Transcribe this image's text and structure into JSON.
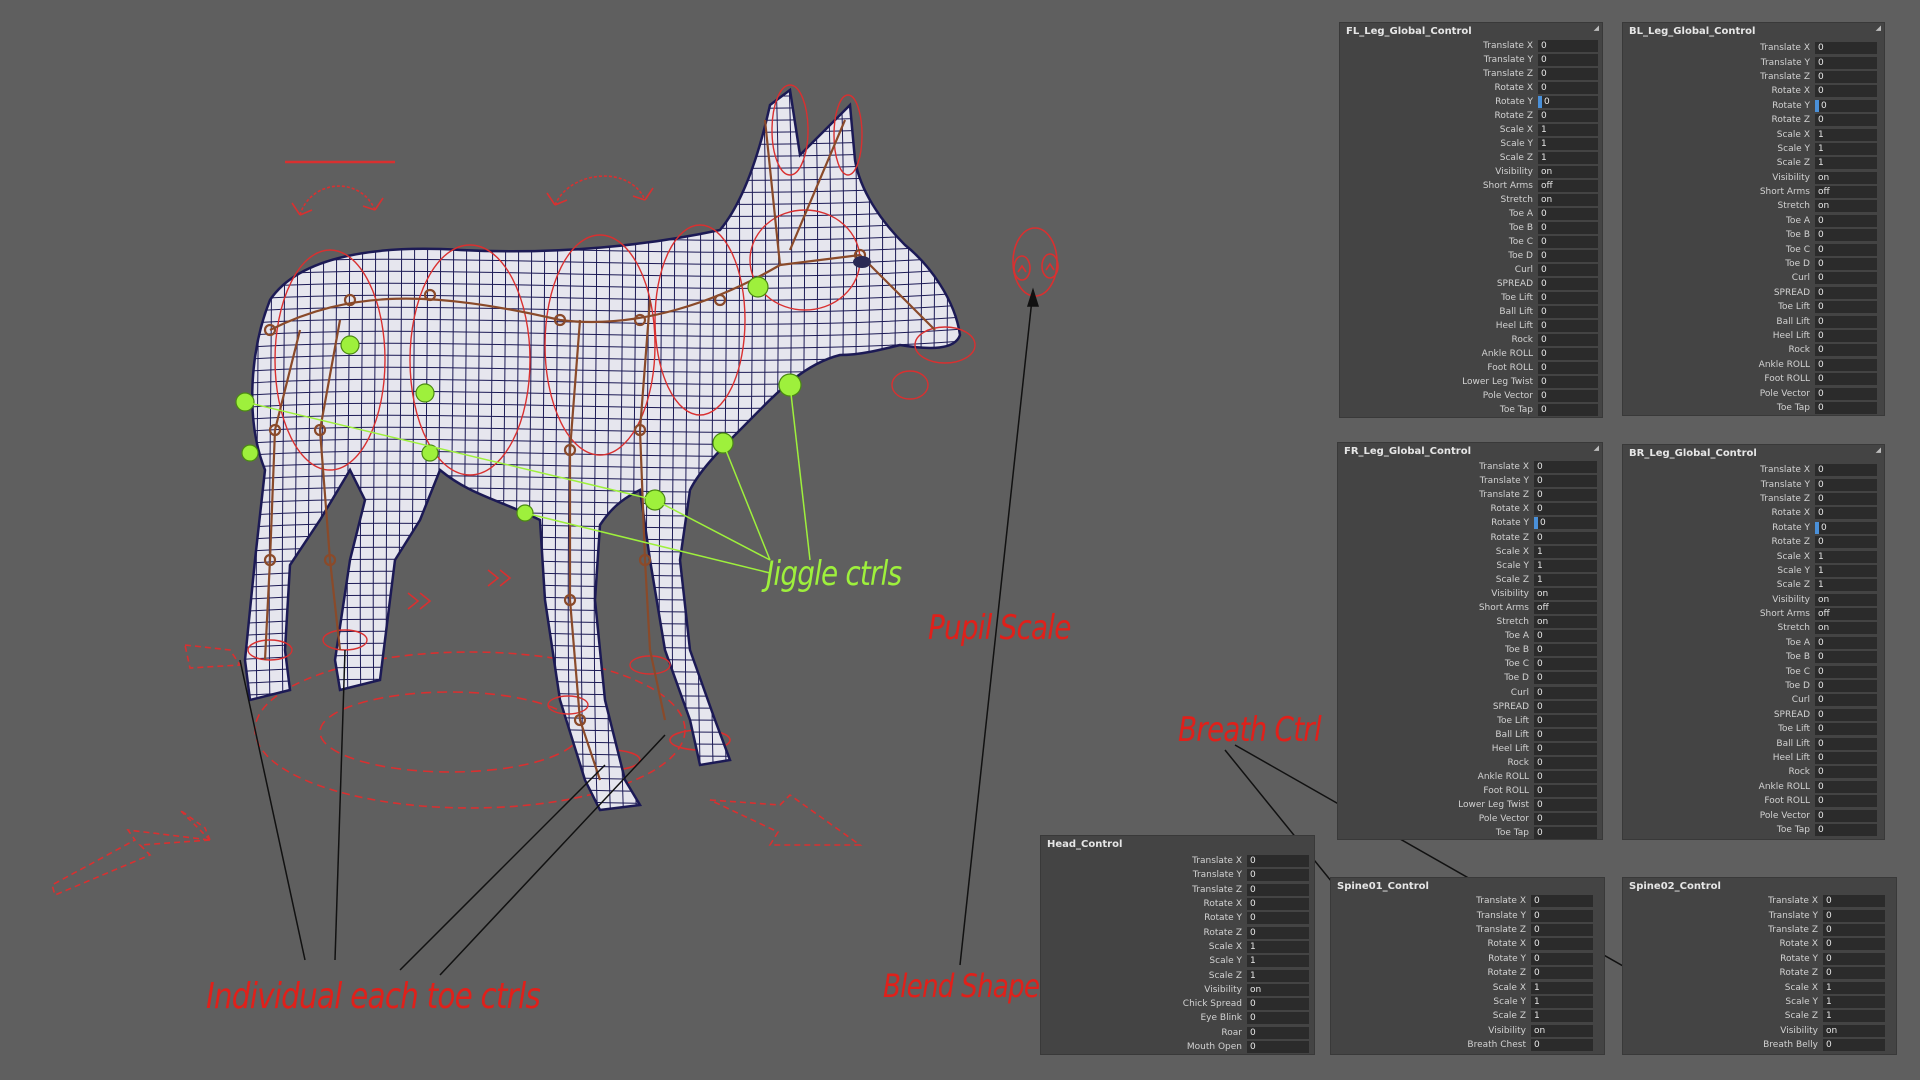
{
  "colors": {
    "background": "#5f5f5f",
    "panel_bg": "#444444",
    "field_bg": "#2b2b2b",
    "annotation_red": "#e0201a",
    "annotation_green": "#9ef03c",
    "wireframe": "#1c1a55",
    "rig_controls": "#d93030",
    "skeleton": "#8a4a2a",
    "selected_slot": "#4a90d9"
  },
  "annotations": {
    "jiggle": "Jiggle ctrls",
    "pupil": "Pupil Scale",
    "breath": "Breath Ctrl",
    "blend": "Blend Shapes",
    "toes": "Individual each toe ctrls"
  },
  "panels": {
    "fl": {
      "title": "FL_Leg_Global_Control",
      "attrs": [
        {
          "label": "Translate X",
          "value": "0"
        },
        {
          "label": "Translate Y",
          "value": "0"
        },
        {
          "label": "Translate Z",
          "value": "0"
        },
        {
          "label": "Rotate X",
          "value": "0"
        },
        {
          "label": "Rotate Y",
          "value": "0",
          "selected": true
        },
        {
          "label": "Rotate Z",
          "value": "0"
        },
        {
          "label": "Scale X",
          "value": "1"
        },
        {
          "label": "Scale Y",
          "value": "1"
        },
        {
          "label": "Scale Z",
          "value": "1"
        },
        {
          "label": "Visibility",
          "value": "on"
        },
        {
          "label": "Short Arms",
          "value": "off"
        },
        {
          "label": "Stretch",
          "value": "on"
        },
        {
          "label": "Toe A",
          "value": "0"
        },
        {
          "label": "Toe B",
          "value": "0"
        },
        {
          "label": "Toe C",
          "value": "0"
        },
        {
          "label": "Toe D",
          "value": "0"
        },
        {
          "label": "Curl",
          "value": "0"
        },
        {
          "label": "SPREAD",
          "value": "0"
        },
        {
          "label": "Toe Lift",
          "value": "0"
        },
        {
          "label": "Ball Lift",
          "value": "0"
        },
        {
          "label": "Heel Lift",
          "value": "0"
        },
        {
          "label": "Rock",
          "value": "0"
        },
        {
          "label": "Ankle ROLL",
          "value": "0"
        },
        {
          "label": "Foot ROLL",
          "value": "0"
        },
        {
          "label": "Lower Leg Twist",
          "value": "0"
        },
        {
          "label": "Pole Vector",
          "value": "0"
        },
        {
          "label": "Toe Tap",
          "value": "0"
        }
      ]
    },
    "bl": {
      "title": "BL_Leg_Global_Control",
      "attrs": [
        {
          "label": "Translate X",
          "value": "0"
        },
        {
          "label": "Translate Y",
          "value": "0"
        },
        {
          "label": "Translate Z",
          "value": "0"
        },
        {
          "label": "Rotate X",
          "value": "0"
        },
        {
          "label": "Rotate Y",
          "value": "0",
          "selected": true
        },
        {
          "label": "Rotate Z",
          "value": "0"
        },
        {
          "label": "Scale X",
          "value": "1"
        },
        {
          "label": "Scale Y",
          "value": "1"
        },
        {
          "label": "Scale Z",
          "value": "1"
        },
        {
          "label": "Visibility",
          "value": "on"
        },
        {
          "label": "Short Arms",
          "value": "off"
        },
        {
          "label": "Stretch",
          "value": "on"
        },
        {
          "label": "Toe A",
          "value": "0"
        },
        {
          "label": "Toe B",
          "value": "0"
        },
        {
          "label": "Toe C",
          "value": "0"
        },
        {
          "label": "Toe D",
          "value": "0"
        },
        {
          "label": "Curl",
          "value": "0"
        },
        {
          "label": "SPREAD",
          "value": "0"
        },
        {
          "label": "Toe Lift",
          "value": "0"
        },
        {
          "label": "Ball Lift",
          "value": "0"
        },
        {
          "label": "Heel Lift",
          "value": "0"
        },
        {
          "label": "Rock",
          "value": "0"
        },
        {
          "label": "Ankle ROLL",
          "value": "0"
        },
        {
          "label": "Foot ROLL",
          "value": "0"
        },
        {
          "label": "Pole Vector",
          "value": "0"
        },
        {
          "label": "Toe Tap",
          "value": "0"
        }
      ]
    },
    "fr": {
      "title": "FR_Leg_Global_Control",
      "attrs": [
        {
          "label": "Translate X",
          "value": "0"
        },
        {
          "label": "Translate Y",
          "value": "0"
        },
        {
          "label": "Translate Z",
          "value": "0"
        },
        {
          "label": "Rotate X",
          "value": "0"
        },
        {
          "label": "Rotate Y",
          "value": "0",
          "selected": true
        },
        {
          "label": "Rotate Z",
          "value": "0"
        },
        {
          "label": "Scale X",
          "value": "1"
        },
        {
          "label": "Scale Y",
          "value": "1"
        },
        {
          "label": "Scale Z",
          "value": "1"
        },
        {
          "label": "Visibility",
          "value": "on"
        },
        {
          "label": "Short Arms",
          "value": "off"
        },
        {
          "label": "Stretch",
          "value": "on"
        },
        {
          "label": "Toe A",
          "value": "0"
        },
        {
          "label": "Toe B",
          "value": "0"
        },
        {
          "label": "Toe C",
          "value": "0"
        },
        {
          "label": "Toe D",
          "value": "0"
        },
        {
          "label": "Curl",
          "value": "0"
        },
        {
          "label": "SPREAD",
          "value": "0"
        },
        {
          "label": "Toe Lift",
          "value": "0"
        },
        {
          "label": "Ball Lift",
          "value": "0"
        },
        {
          "label": "Heel Lift",
          "value": "0"
        },
        {
          "label": "Rock",
          "value": "0"
        },
        {
          "label": "Ankle ROLL",
          "value": "0"
        },
        {
          "label": "Foot ROLL",
          "value": "0"
        },
        {
          "label": "Lower Leg Twist",
          "value": "0"
        },
        {
          "label": "Pole Vector",
          "value": "0"
        },
        {
          "label": "Toe Tap",
          "value": "0"
        }
      ]
    },
    "br": {
      "title": "BR_Leg_Global_Control",
      "attrs": [
        {
          "label": "Translate X",
          "value": "0"
        },
        {
          "label": "Translate Y",
          "value": "0"
        },
        {
          "label": "Translate Z",
          "value": "0"
        },
        {
          "label": "Rotate X",
          "value": "0"
        },
        {
          "label": "Rotate Y",
          "value": "0",
          "selected": true
        },
        {
          "label": "Rotate Z",
          "value": "0"
        },
        {
          "label": "Scale X",
          "value": "1"
        },
        {
          "label": "Scale Y",
          "value": "1"
        },
        {
          "label": "Scale Z",
          "value": "1"
        },
        {
          "label": "Visibility",
          "value": "on"
        },
        {
          "label": "Short Arms",
          "value": "off"
        },
        {
          "label": "Stretch",
          "value": "on"
        },
        {
          "label": "Toe A",
          "value": "0"
        },
        {
          "label": "Toe B",
          "value": "0"
        },
        {
          "label": "Toe C",
          "value": "0"
        },
        {
          "label": "Toe D",
          "value": "0"
        },
        {
          "label": "Curl",
          "value": "0"
        },
        {
          "label": "SPREAD",
          "value": "0"
        },
        {
          "label": "Toe Lift",
          "value": "0"
        },
        {
          "label": "Ball Lift",
          "value": "0"
        },
        {
          "label": "Heel Lift",
          "value": "0"
        },
        {
          "label": "Rock",
          "value": "0"
        },
        {
          "label": "Ankle ROLL",
          "value": "0"
        },
        {
          "label": "Foot ROLL",
          "value": "0"
        },
        {
          "label": "Pole Vector",
          "value": "0"
        },
        {
          "label": "Toe Tap",
          "value": "0"
        }
      ]
    },
    "head": {
      "title": "Head_Control",
      "attrs": [
        {
          "label": "Translate X",
          "value": "0"
        },
        {
          "label": "Translate Y",
          "value": "0"
        },
        {
          "label": "Translate Z",
          "value": "0"
        },
        {
          "label": "Rotate X",
          "value": "0"
        },
        {
          "label": "Rotate Y",
          "value": "0"
        },
        {
          "label": "Rotate Z",
          "value": "0"
        },
        {
          "label": "Scale X",
          "value": "1"
        },
        {
          "label": "Scale Y",
          "value": "1"
        },
        {
          "label": "Scale Z",
          "value": "1"
        },
        {
          "label": "Visibility",
          "value": "on"
        },
        {
          "label": "Chick Spread",
          "value": "0"
        },
        {
          "label": "Eye Blink",
          "value": "0"
        },
        {
          "label": "Roar",
          "value": "0"
        },
        {
          "label": "Mouth Open",
          "value": "0"
        }
      ]
    },
    "spine01": {
      "title": "Spine01_Control",
      "attrs": [
        {
          "label": "Translate X",
          "value": "0"
        },
        {
          "label": "Translate Y",
          "value": "0"
        },
        {
          "label": "Translate Z",
          "value": "0"
        },
        {
          "label": "Rotate X",
          "value": "0"
        },
        {
          "label": "Rotate Y",
          "value": "0"
        },
        {
          "label": "Rotate Z",
          "value": "0"
        },
        {
          "label": "Scale X",
          "value": "1"
        },
        {
          "label": "Scale Y",
          "value": "1"
        },
        {
          "label": "Scale Z",
          "value": "1"
        },
        {
          "label": "Visibility",
          "value": "on"
        },
        {
          "label": "Breath Chest",
          "value": "0"
        }
      ]
    },
    "spine02": {
      "title": "Spine02_Control",
      "attrs": [
        {
          "label": "Translate X",
          "value": "0"
        },
        {
          "label": "Translate Y",
          "value": "0"
        },
        {
          "label": "Translate Z",
          "value": "0"
        },
        {
          "label": "Rotate X",
          "value": "0"
        },
        {
          "label": "Rotate Y",
          "value": "0"
        },
        {
          "label": "Rotate Z",
          "value": "0"
        },
        {
          "label": "Scale X",
          "value": "1"
        },
        {
          "label": "Scale Y",
          "value": "1"
        },
        {
          "label": "Scale Z",
          "value": "1"
        },
        {
          "label": "Visibility",
          "value": "on"
        },
        {
          "label": "Breath Belly",
          "value": "0"
        }
      ]
    }
  }
}
